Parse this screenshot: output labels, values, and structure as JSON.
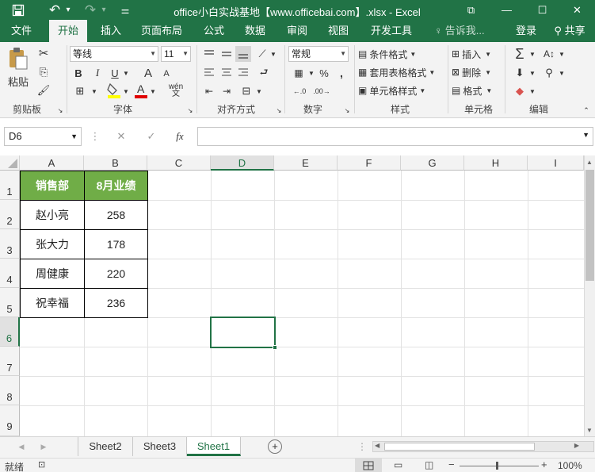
{
  "app": {
    "title": "office小白实战基地【www.officebai.com】.xlsx - Excel"
  },
  "quick_access": {
    "save_icon": "save-icon",
    "undo_icon": "undo-icon",
    "redo_icon": "redo-icon",
    "customize_icon": "customize-icon",
    "undo_glyph": "↶",
    "redo_glyph": "↷",
    "dropdown_glyph": "▾",
    "customize_glyph": "⚌"
  },
  "window_controls": {
    "restore_glyph": "⧉",
    "minimize_glyph": "—",
    "maximize_glyph": "☐",
    "close_glyph": "✕"
  },
  "tabs": [
    "文件",
    "开始",
    "插入",
    "页面布局",
    "公式",
    "数据",
    "审阅",
    "视图",
    "开发工具"
  ],
  "active_tab": "开始",
  "tell_me": "告诉我...",
  "login": "登录",
  "share": "共享",
  "ribbon": {
    "clipboard": {
      "paste": "粘贴",
      "label": "剪贴板"
    },
    "font": {
      "name": "等线",
      "size": "11",
      "label": "字体",
      "bold": "B",
      "italic": "I",
      "underline": "U",
      "grow": "A",
      "shrink": "A",
      "phonetic": "wén"
    },
    "alignment": {
      "label": "对齐方式"
    },
    "number": {
      "format": "常规",
      "label": "数字",
      "percent": "%",
      "comma": ","
    },
    "styles": {
      "conditional": "条件格式",
      "table": "套用表格格式",
      "cell": "单元格样式",
      "label": "样式"
    },
    "cells": {
      "insert": "插入",
      "delete": "删除",
      "format": "格式",
      "label": "单元格"
    },
    "editing": {
      "label": "编辑",
      "sum": "Σ"
    }
  },
  "formula_bar": {
    "name_box": "D6",
    "cancel": "✕",
    "enter": "✓",
    "fx": "fx",
    "value": ""
  },
  "columns": [
    "A",
    "B",
    "C",
    "D",
    "E",
    "F",
    "G",
    "H",
    "I"
  ],
  "rows": [
    "1",
    "2",
    "3",
    "4",
    "5",
    "6",
    "7",
    "8",
    "9"
  ],
  "table": {
    "headers": [
      "销售部",
      "8月业绩"
    ],
    "rows": [
      [
        "赵小亮",
        "258"
      ],
      [
        "张大力",
        "178"
      ],
      [
        "周健康",
        "220"
      ],
      [
        "祝幸福",
        "236"
      ]
    ]
  },
  "selected_cell": "D6",
  "sheets": [
    "Sheet2",
    "Sheet3",
    "Sheet1"
  ],
  "active_sheet": "Sheet1",
  "status": {
    "ready": "就绪",
    "zoom": "100%",
    "minus": "−",
    "plus": "+"
  },
  "colors": {
    "excel_green": "#217346",
    "header_fill": "#70ad47",
    "header_text": "#ffffff"
  }
}
